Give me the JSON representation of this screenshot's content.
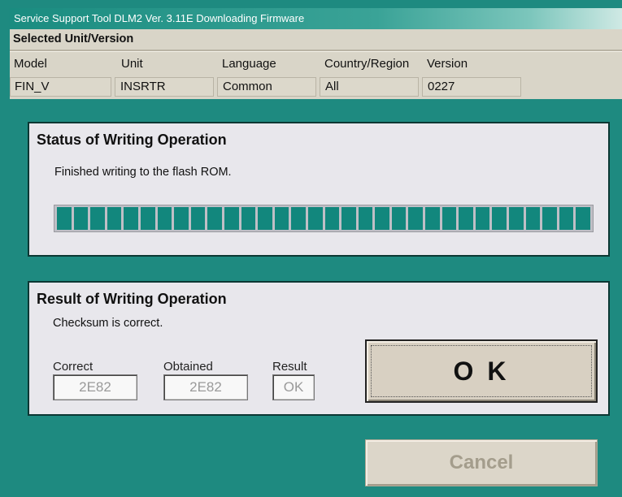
{
  "window": {
    "title": "Service Support Tool DLM2 Ver. 3.11E  Downloading Firmware"
  },
  "selected": {
    "title": "Selected Unit/Version",
    "headers": [
      "Model",
      "Unit",
      "Language",
      "Country/Region",
      "Version"
    ],
    "values": [
      "FIN_V",
      "INSRTR",
      "Common",
      "All",
      "0227"
    ]
  },
  "status": {
    "title": "Status of Writing Operation",
    "message": "Finished writing to the flash ROM.",
    "progress_segments": 32,
    "progress_fraction": 1.0,
    "progress_color": "#12877d"
  },
  "result": {
    "title": "Result of Writing Operation",
    "message": "Checksum is correct.",
    "correct_label": "Correct",
    "correct_value": "2E82",
    "obtained_label": "Obtained",
    "obtained_value": "2E82",
    "result_label": "Result",
    "result_value": "OK"
  },
  "buttons": {
    "ok_label": "O K",
    "cancel_label": "Cancel"
  }
}
